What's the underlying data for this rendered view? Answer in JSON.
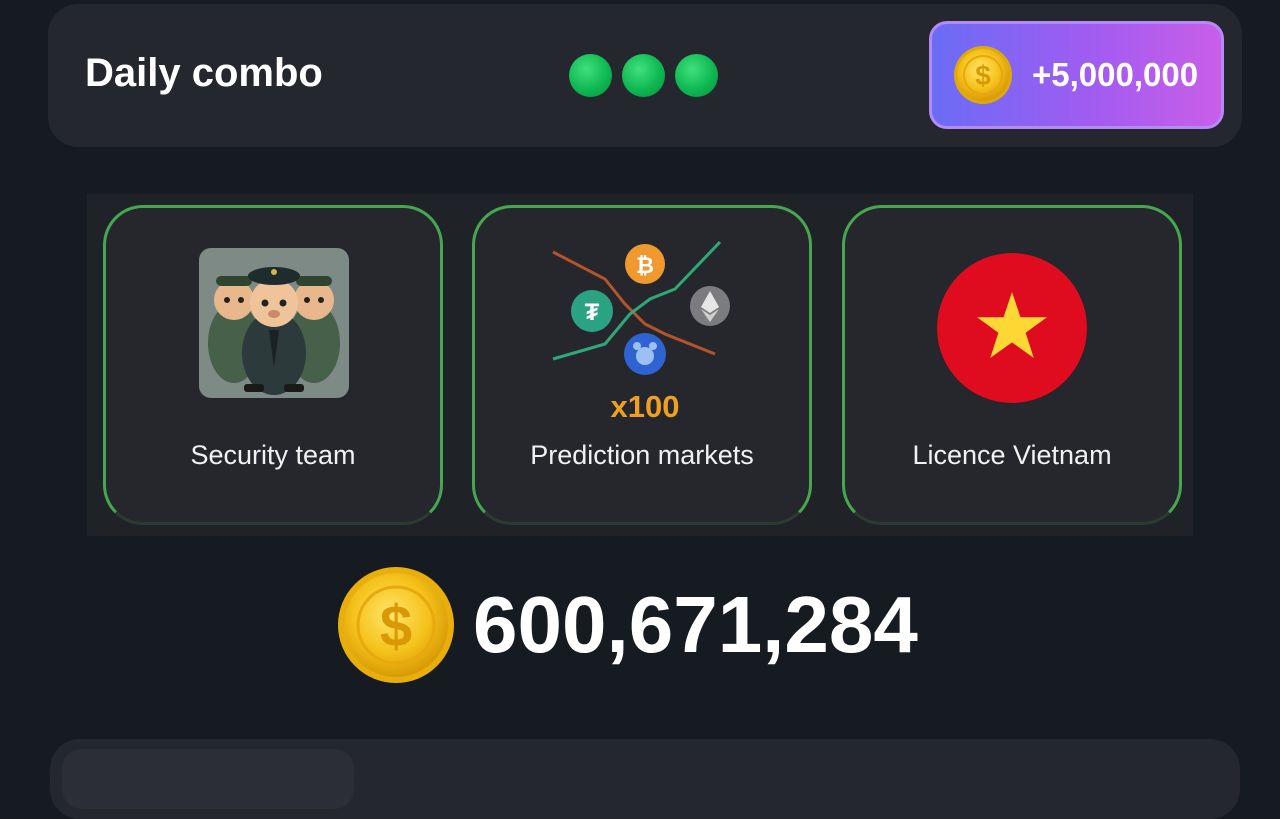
{
  "daily_combo": {
    "title": "Daily combo",
    "found_count": 3,
    "indicator_color": "#12c05a",
    "reward_label": "+5,000,000",
    "reward_icon": "coin-icon"
  },
  "cards": [
    {
      "label": "Security team",
      "icon": "security-team-hamsters-image"
    },
    {
      "label": "Prediction markets",
      "icon": "prediction-markets-image",
      "multiplier": "x100"
    },
    {
      "label": "Licence Vietnam",
      "icon": "vietnam-flag-icon"
    }
  ],
  "balance": {
    "value": "600,671,284",
    "icon": "coin-icon"
  },
  "colors": {
    "background": "#161a21",
    "panel": "#24272e",
    "card_border": "#47a750",
    "reward_gradient_start": "#6a6cf6",
    "reward_gradient_end": "#c95ee9",
    "coin": "#f5c21b"
  }
}
